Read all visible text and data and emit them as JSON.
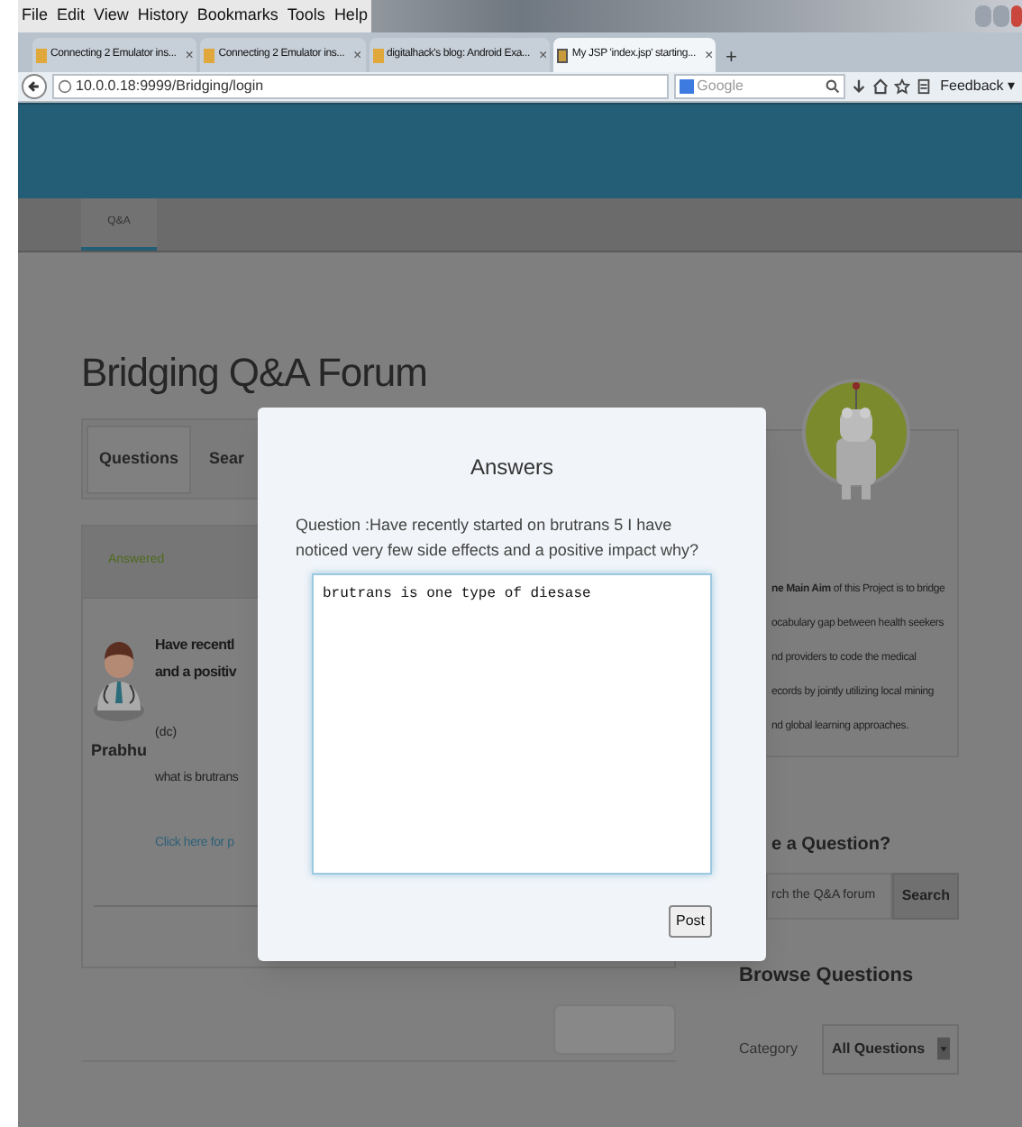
{
  "browser": {
    "menu": [
      "File",
      "Edit",
      "View",
      "History",
      "Bookmarks",
      "Tools",
      "Help"
    ],
    "tabs": [
      {
        "title": "Connecting 2 Emulator ins...",
        "close": "×",
        "selected": false
      },
      {
        "title": "Connecting 2 Emulator ins...",
        "close": "×",
        "selected": false
      },
      {
        "title": "digitalhack's blog: Android Exa...",
        "close": "×",
        "selected": false
      },
      {
        "title": "My JSP 'index.jsp' starting...",
        "close": "×",
        "selected": true
      }
    ],
    "new_tab": "+",
    "url": "10.0.0.18:9999/Bridging/login",
    "search_placeholder": "Google",
    "feedback": "Feedback",
    "feedback_arrow": "▾"
  },
  "site": {
    "nav_tabs": [
      {
        "label": "Q&A",
        "selected": true
      }
    ],
    "title": "Bridging Q&A Forum",
    "section_tabs": [
      {
        "label": "Questions",
        "selected": true
      },
      {
        "label": "Sear",
        "selected": false
      }
    ],
    "status": "Answered",
    "question": {
      "author": "Prabhu",
      "title_lines": [
        "Have recentl",
        "and a positiv"
      ],
      "meta": "(dc)",
      "body": "what is brutrans",
      "link": "Click here for p"
    },
    "about": [
      "**ne Main Aim** of this Project is to bridge",
      "ocabulary gap between health seekers",
      "nd providers to code the medical",
      "ecords by jointly utilizing local mining",
      "nd global learning approaches."
    ],
    "ask_title": "e a Question?",
    "search": {
      "placeholder": "rch the Q&A forum",
      "button": "Search"
    },
    "browse_title": "Browse Questions",
    "category_label": "Category",
    "category_value": "All Questions"
  },
  "dialog": {
    "title": "Answers",
    "question": "Question :Have recently started on brutrans 5 I have noticed very few side effects and a positive impact why?",
    "answer": "brutrans is one type of diesase",
    "button": "Post"
  }
}
